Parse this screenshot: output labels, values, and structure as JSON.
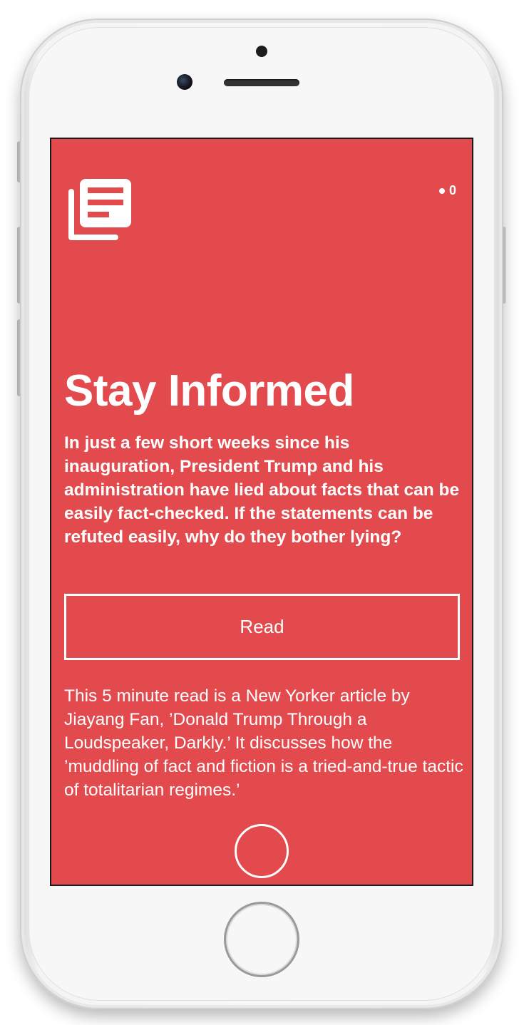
{
  "device": {
    "body_color": "#f7f7f7",
    "accent_color": "#e34a4d"
  },
  "header": {
    "logo_icon": "newspaper-stack-icon",
    "page_count": "0"
  },
  "article": {
    "title": "Stay Informed",
    "summary": "In just a few short weeks since his inauguration, President Trump and his administration have lied about facts that can be easily fact-checked. If the statements can be refuted easily, why do they bother lying?",
    "read_button_label": "Read",
    "description": "This 5 minute read is a New Yorker article by Jiayang Fan, ’Donald Trump Through a Loudspeaker, Darkly.’ It discusses how the ’muddling of fact and fiction is a tried-and-true tactic of totalitarian regimes.’"
  },
  "footer": {
    "circle_button_icon": "circle-outline-icon"
  }
}
